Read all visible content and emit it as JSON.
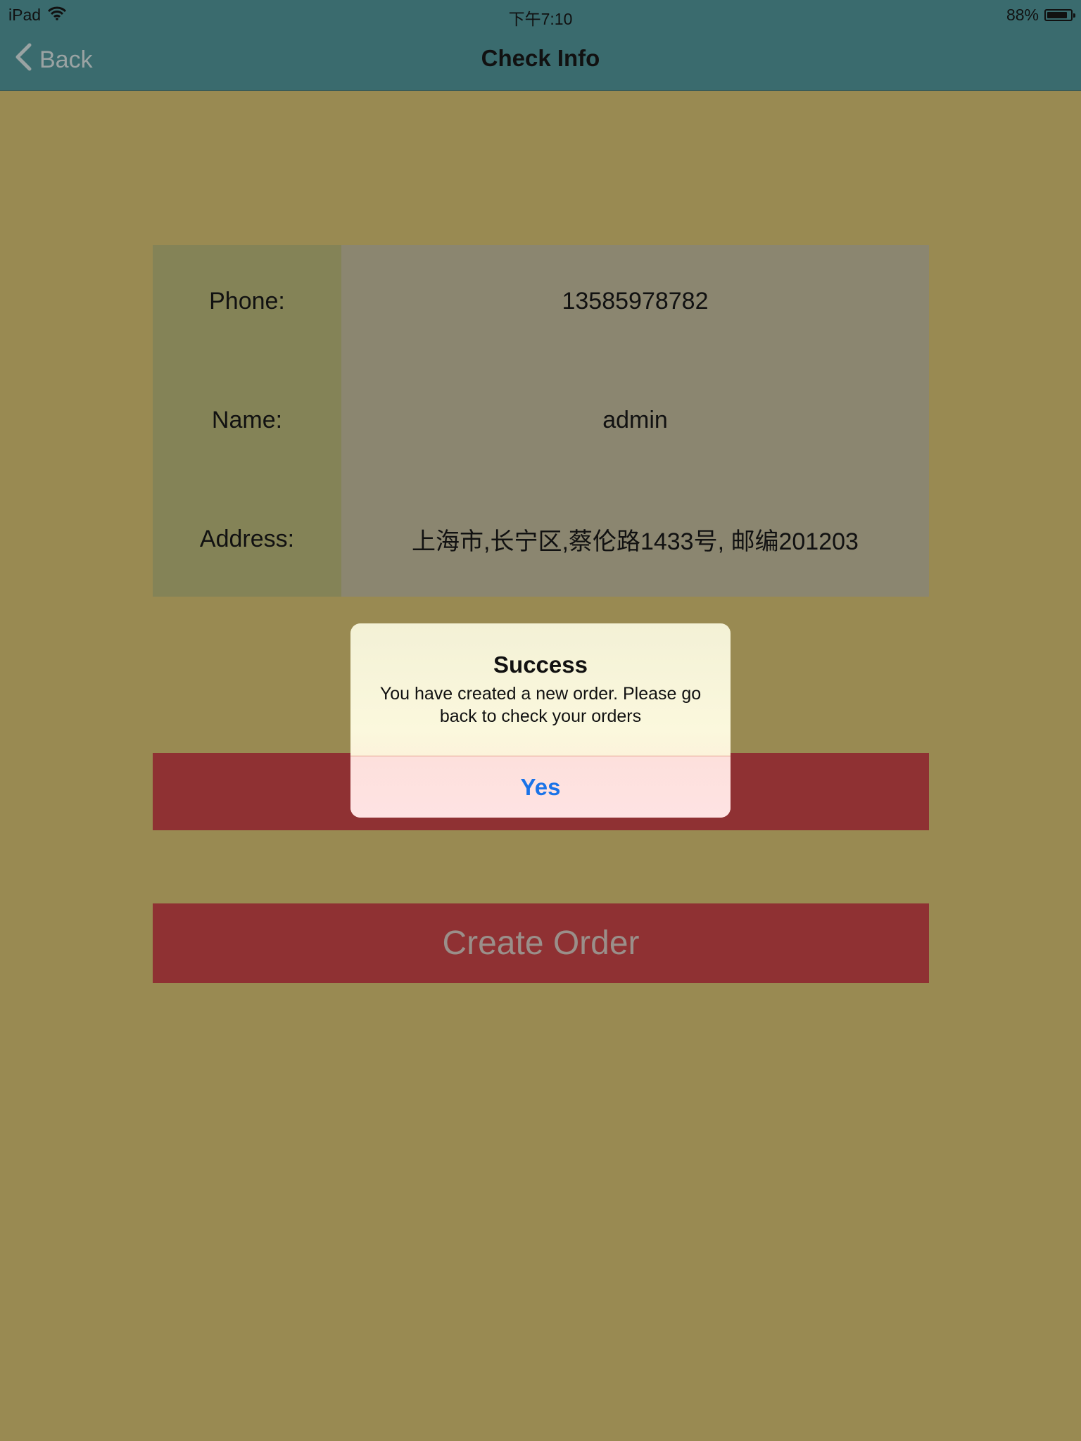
{
  "status_bar": {
    "device": "iPad",
    "time": "下午7:10",
    "battery": "88%",
    "battery_level": 0.88
  },
  "nav": {
    "back_label": "Back",
    "title": "Check Info"
  },
  "info": {
    "rows": [
      {
        "label": "Phone:",
        "value": "13585978782"
      },
      {
        "label": "Name:",
        "value": "admin"
      },
      {
        "label": "Address:",
        "value": "上海市,长宁区,蔡伦路1433号, 邮编201203"
      }
    ]
  },
  "buttons": {
    "create_order_label": "Create Order"
  },
  "alert": {
    "title": "Success",
    "message": "You have created a new order. Please go back to check your orders",
    "confirm_label": "Yes"
  },
  "colors": {
    "background": "#998a52",
    "nav_bar": "#3a6b6e",
    "button_red": "#8f3133",
    "alert_button_text": "#1a73e8"
  },
  "icons": [
    "wifi-icon",
    "battery-icon",
    "chevron-left-icon"
  ]
}
